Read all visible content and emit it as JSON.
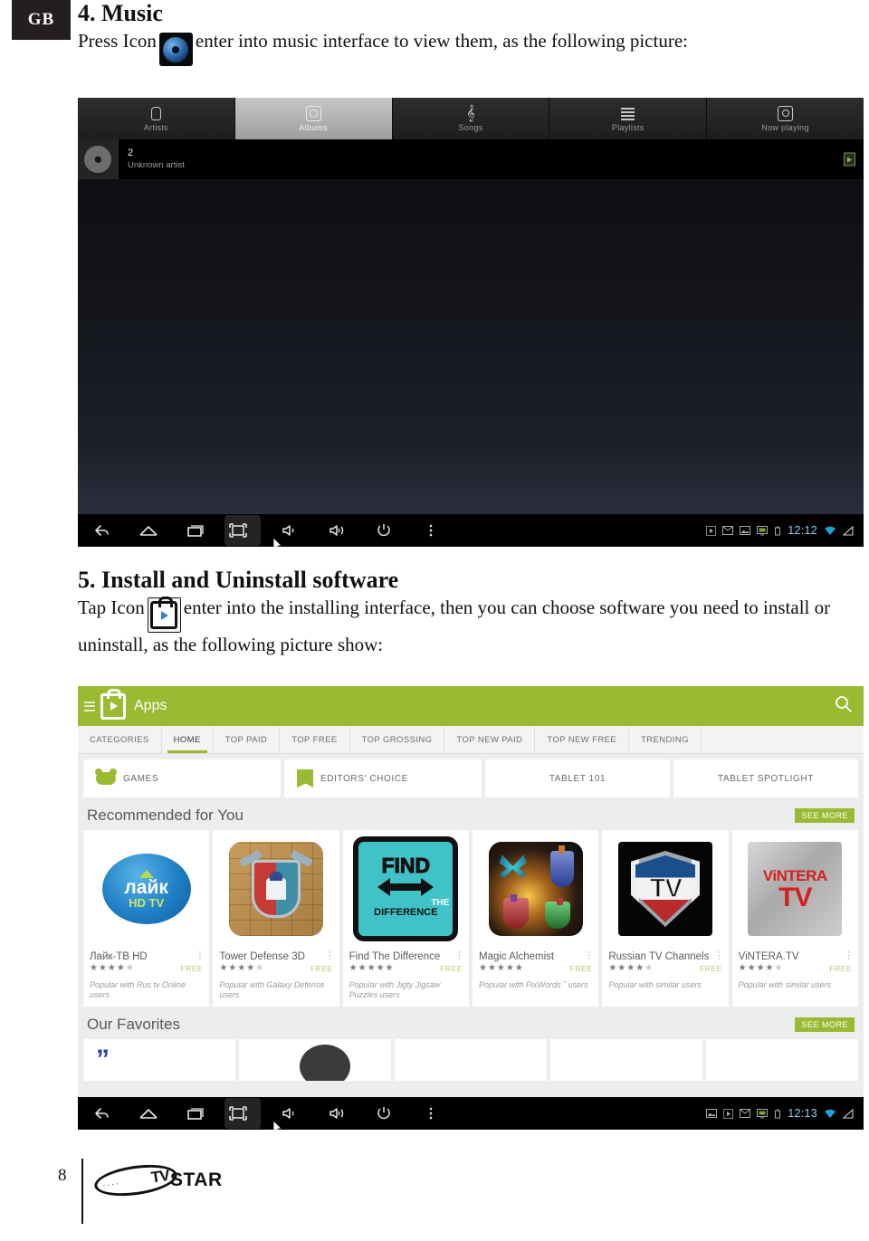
{
  "page": {
    "region_badge": "GB",
    "page_number": "8",
    "brand_tv": "TV",
    "brand_star": "STAR"
  },
  "section4": {
    "title": "4. Music",
    "body_before": "Press Icon",
    "body_after": "enter into music interface to view them, as the following picture:",
    "icon_name": "music-app-icon"
  },
  "section5": {
    "title": "5. Install and Uninstall software",
    "body_before": "Tap Icon",
    "body_after": "enter into the installing interface, then you can choose software you need to install or uninstall, as the following picture show:",
    "icon_name": "play-store-app-icon"
  },
  "music_screen": {
    "tabs": [
      {
        "label": "Artists",
        "icon": "microphone-icon",
        "selected": false
      },
      {
        "label": "Albums",
        "icon": "album-disc-icon",
        "selected": true
      },
      {
        "label": "Songs",
        "icon": "treble-clef-icon",
        "selected": false
      },
      {
        "label": "Playlists",
        "icon": "list-icon",
        "selected": false
      },
      {
        "label": "Now playing",
        "icon": "now-playing-icon",
        "selected": false
      }
    ],
    "album_row": {
      "title": "2",
      "subtitle": "Unknown artist",
      "art_icon": "disc-icon",
      "play_icon": "play-icon"
    },
    "navbar": {
      "buttons": [
        {
          "name": "back-button",
          "icon": "back-arrow-icon",
          "highlighted": false
        },
        {
          "name": "home-button",
          "icon": "home-icon",
          "highlighted": false
        },
        {
          "name": "recents-button",
          "icon": "recents-icon",
          "highlighted": false
        },
        {
          "name": "screenshot-button",
          "icon": "screenshot-icon",
          "highlighted": true
        },
        {
          "name": "volume-down-button",
          "icon": "volume-down-icon",
          "highlighted": false
        },
        {
          "name": "volume-up-button",
          "icon": "volume-up-icon",
          "highlighted": false
        },
        {
          "name": "power-button",
          "icon": "power-icon",
          "highlighted": false
        },
        {
          "name": "overflow-menu-button",
          "icon": "more-vertical-icon",
          "highlighted": false
        }
      ],
      "status_icons": [
        "play-status-icon",
        "mail-icon",
        "screenshot-status-icon",
        "display-icon",
        "usb-icon"
      ],
      "clock": "12:12",
      "wifi_icon": "wifi-icon",
      "battery_icon": "battery-icon"
    }
  },
  "play_store": {
    "header": {
      "menu_icon": "hamburger-menu-icon",
      "logo_icon": "play-store-bag-icon",
      "title": "Apps",
      "search_icon": "search-icon",
      "accent_color": "#9aba33"
    },
    "tabs": [
      {
        "label": "CATEGORIES",
        "selected": false
      },
      {
        "label": "HOME",
        "selected": true
      },
      {
        "label": "TOP PAID",
        "selected": false
      },
      {
        "label": "TOP FREE",
        "selected": false
      },
      {
        "label": "TOP GROSSING",
        "selected": false
      },
      {
        "label": "TOP NEW PAID",
        "selected": false
      },
      {
        "label": "TOP NEW FREE",
        "selected": false
      },
      {
        "label": "TRENDING",
        "selected": false
      }
    ],
    "quick_links": [
      {
        "label": "GAMES",
        "icon": "gamepad-icon"
      },
      {
        "label": "EDITORS' CHOICE",
        "icon": "editors-choice-icon"
      },
      {
        "label": "TABLET 101",
        "icon": ""
      },
      {
        "label": "TABLET SPOTLIGHT",
        "icon": ""
      }
    ],
    "sections": [
      {
        "title": "Recommended for You",
        "see_more": "SEE MORE"
      },
      {
        "title": "Our Favorites",
        "see_more": "SEE MORE"
      }
    ],
    "apps": [
      {
        "name": "Лайк-ТВ HD",
        "stars": 3.5,
        "price": "FREE",
        "note": "Popular with Rus tv Online users",
        "art_text_1": "лайк",
        "art_text_2": "HD TV",
        "art_style": "like-hd-tv"
      },
      {
        "name": "Tower Defense 3D",
        "stars": 4,
        "price": "FREE",
        "note": "Popular with Galaxy Defense users",
        "art_text_1": "",
        "art_text_2": "",
        "art_style": "tower-defense"
      },
      {
        "name": "Find The Difference",
        "stars": 4.5,
        "price": "FREE",
        "note": "Popular with Jigty Jigsaw Puzzles users",
        "art_text_1": "FIND",
        "art_text_2": "DIFFERENCE",
        "art_style": "find-difference"
      },
      {
        "name": "Magic Alchemist",
        "stars": 4.5,
        "price": "FREE",
        "note": "Popular with PixWords ˝ users",
        "art_text_1": "",
        "art_text_2": "",
        "art_style": "magic-alchemist"
      },
      {
        "name": "Russian TV Channels",
        "stars": 3.5,
        "price": "FREE",
        "note": "Popular with similar users",
        "art_text_1": "TV",
        "art_text_2": "",
        "art_style": "russian-tv"
      },
      {
        "name": "ViNTERA.TV",
        "stars": 4,
        "price": "FREE",
        "note": "Popular with similar users",
        "art_text_1": "ViNTERA",
        "art_text_2": "TV",
        "art_style": "vintera-tv"
      }
    ],
    "navbar": {
      "buttons": [
        {
          "name": "back-button",
          "icon": "back-arrow-icon",
          "highlighted": false
        },
        {
          "name": "home-button",
          "icon": "home-icon",
          "highlighted": false
        },
        {
          "name": "recents-button",
          "icon": "recents-icon",
          "highlighted": false
        },
        {
          "name": "screenshot-button",
          "icon": "screenshot-icon",
          "highlighted": true
        },
        {
          "name": "volume-down-button",
          "icon": "volume-down-icon",
          "highlighted": false
        },
        {
          "name": "volume-up-button",
          "icon": "volume-up-icon",
          "highlighted": false
        },
        {
          "name": "power-button",
          "icon": "power-icon",
          "highlighted": false
        },
        {
          "name": "overflow-menu-button",
          "icon": "more-vertical-icon",
          "highlighted": false
        }
      ],
      "status_icons": [
        "screenshot-status-icon",
        "play-status-icon",
        "mail-icon",
        "display-icon",
        "usb-icon"
      ],
      "clock": "12:13",
      "wifi_icon": "wifi-icon",
      "battery_icon": "battery-icon"
    }
  }
}
